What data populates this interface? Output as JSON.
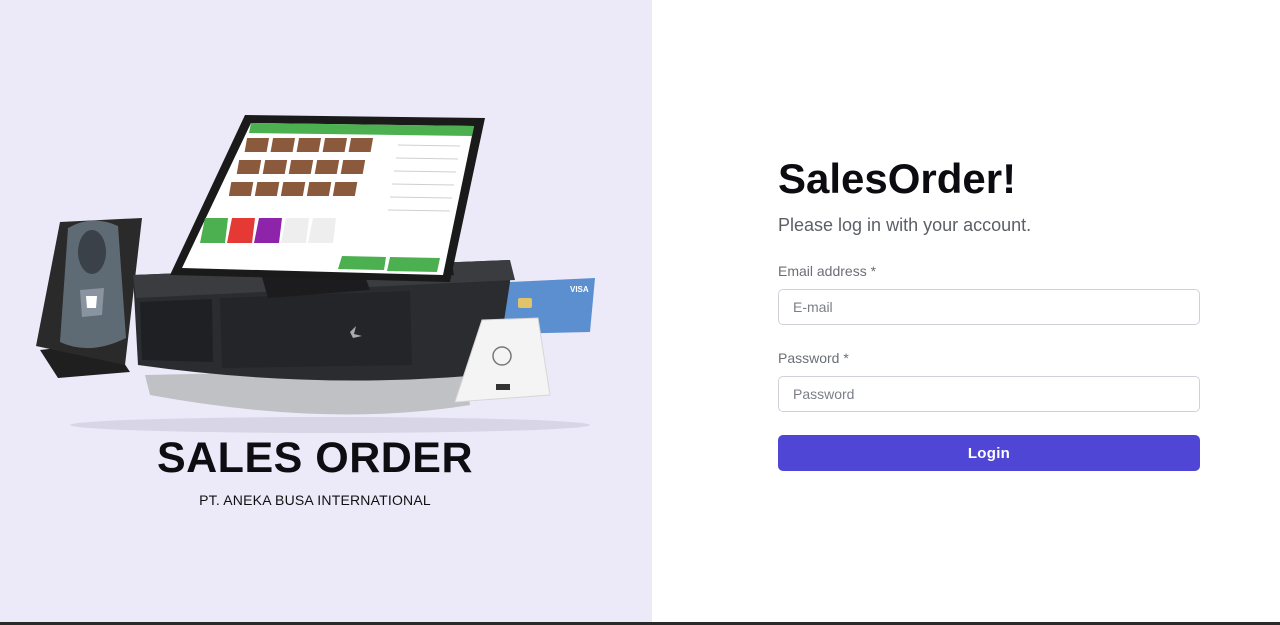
{
  "brand": {
    "title": "SALES ORDER",
    "subtitle": "PT. ANEKA BUSA INTERNATIONAL"
  },
  "hero": {
    "image_description_icon": "pos-terminal-illustration-icon",
    "card_brand": "VISA"
  },
  "login": {
    "title": "SalesOrder!",
    "lead": "Please log in with your account.",
    "email_label": "Email address *",
    "email_placeholder": "E-mail",
    "email_value": "",
    "password_label": "Password *",
    "password_placeholder": "Password",
    "password_value": "",
    "submit_label": "Login"
  },
  "colors": {
    "left_background": "#eceaf9",
    "accent": "#4f46d6",
    "pos_green": "#4caf50"
  }
}
